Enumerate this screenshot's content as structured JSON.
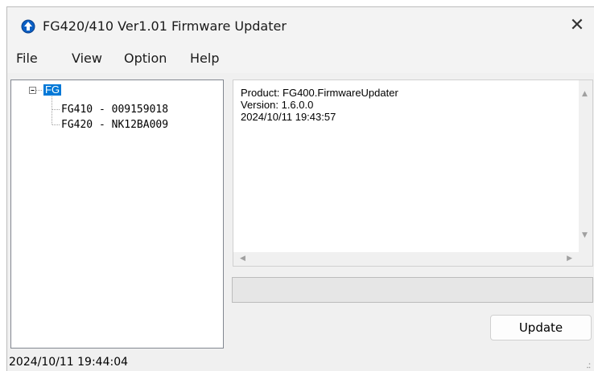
{
  "window": {
    "title": "FG420/410 Ver1.01 Firmware Updater",
    "close_symbol": "✕",
    "app_icon": "upload-arrow-icon",
    "accent": "#0078d7"
  },
  "menu": {
    "items": [
      "File",
      "View",
      "Option",
      "Help"
    ]
  },
  "tree": {
    "root_label": "FG",
    "children": [
      "FG410 - 009159018",
      "FG420 - NK12BA009"
    ]
  },
  "info": {
    "lines": [
      "Product: FG400.FirmwareUpdater",
      "Version: 1.6.0.0",
      "2024/10/11 19:43:57"
    ]
  },
  "progress": {
    "value": 0
  },
  "buttons": {
    "update_label": "Update"
  },
  "status": {
    "text": "2024/10/11 19:44:04"
  }
}
